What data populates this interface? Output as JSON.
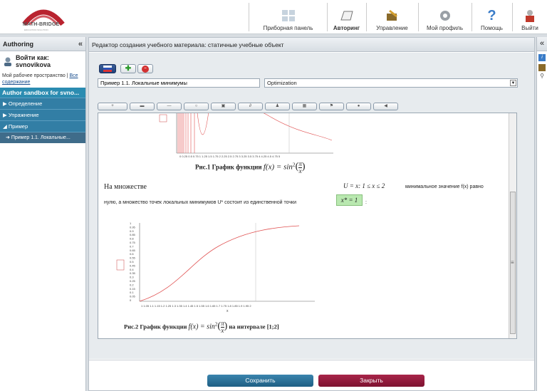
{
  "header": {
    "logo_text": "MATH-BRIDGE",
    "logo_sub": "EDUCATION SOLUTION",
    "nav": [
      {
        "label": "Приборная панель",
        "icon": "dashboard-icon"
      },
      {
        "label": "Авторинг",
        "icon": "authoring-icon"
      },
      {
        "label": "Управление",
        "icon": "management-icon"
      },
      {
        "label": "Мой профиль",
        "icon": "profile-gear-icon"
      },
      {
        "label": "Помощь",
        "icon": "help-icon"
      },
      {
        "label": "Выйти",
        "icon": "logout-icon"
      }
    ]
  },
  "left_panel": {
    "title": "Authoring",
    "login": "Войти как: svnovikova",
    "workspace": "Мой рабочее пространство |",
    "workspace_link": "Все содержание",
    "sandbox": "Author sandbox for svno...",
    "tree": [
      {
        "label": "Определение",
        "arrow": "▶"
      },
      {
        "label": "Упражнение",
        "arrow": "▶"
      },
      {
        "label": "Пример",
        "arrow": "◢"
      }
    ],
    "selected": "Пример 1.1. Локальные..."
  },
  "editor": {
    "title": "Редактор создания учебного материала: статичные учебные объект",
    "name_value": "Пример 1.1. Локальные минимумы",
    "topic_value": "Optimization",
    "fig1_caption": "Рис.1 График функции",
    "fig1_ticks": "0 0.25 0.5 0.75 1 1.25 1.5 1.75 2 2.25 2.5 2.75 3 3.25 3.5 3.75 4 4.25 4.5 4.75 5",
    "text_line1_left": "На множестве",
    "text_line1_set": "U = x: 1 ≤ x ≤ 2",
    "text_line1_right": "минимальное значение f(x) равно",
    "text_line2": "нулю, а множество точек локальных минимумов U* состоит из единственной точки",
    "highlight": "x* = 1",
    "text_line2_end": ":",
    "fig2_caption": "Рис.2 График функции",
    "fig2_suffix": "на интервале [1;2]",
    "fig2_xticks": "1 1.05 1.1 1.15 1.2 1.25 1.3 1.35 1.4 1.45 1.5 1.55 1.6 1.65 1.7 1.75 1.8 1.85 1.9 1.95 2",
    "fig2_yticks": [
      "1",
      "0.95",
      "0.9",
      "0.85",
      "0.8",
      "0.75",
      "0.7",
      "0.65",
      "0.6",
      "0.55",
      "0.5",
      "0.45",
      "0.4",
      "0.35",
      "0.3",
      "0.25",
      "0.2",
      "0.15",
      "0.1",
      "0.05",
      "0"
    ],
    "formula_f": "f(x) = sin",
    "formula_pi": "π",
    "formula_x": "x",
    "formula_sq": "2",
    "axis_x": "x",
    "scroll_marker": "≡"
  },
  "buttons": {
    "save": "Сохранить",
    "close": "Закрыть"
  },
  "colors": {
    "save_btn": "#2b6f94",
    "close_btn": "#8e1736",
    "sandbox": "#2b8cb1",
    "curve": "#e05050"
  }
}
